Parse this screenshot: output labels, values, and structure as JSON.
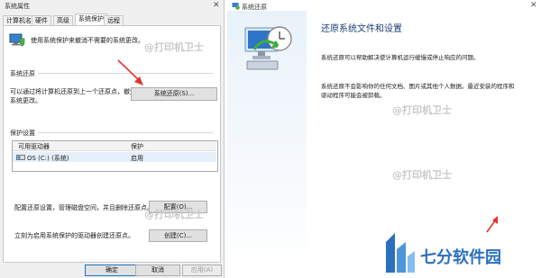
{
  "dialog": {
    "title": "系统属性",
    "close": "✕",
    "tabs": [
      "计算机名",
      "硬件",
      "高级",
      "系统保护",
      "远程"
    ],
    "intro": "使用系统保护来撤消不需要的系统更改。",
    "restore_section": "系统还原",
    "restore_desc_1": "可以通过将计算机还原到上一个还原点，撤消",
    "restore_desc_2": "系统更改。",
    "restore_button": "系统还原(S)...",
    "protection_section": "保护设置",
    "list_headers": [
      "可用驱动器",
      "保护"
    ],
    "drive_name": "OS (C:) (系统)",
    "drive_status": "启用",
    "config_desc": "配置还原设置，管理磁盘空间，并且删除还原点。",
    "config_button": "配置(O)...",
    "create_desc": "立刻为启用系统保护的驱动器创建还原点。",
    "create_button": "创建(C)...",
    "ok": "确定",
    "cancel": "取消",
    "apply": "应用(A)"
  },
  "restore_window": {
    "title": "系统还原",
    "heading": "还原系统文件和设置",
    "p1": "系统还原可以帮助解决使计算机运行缓慢或停止响应的问题。",
    "p2a": "系统还原不会影响你的任何文档、图片或其他个人数据。最近安装的程序和",
    "p2b": "驱动程序可能会被卸载。",
    "close": "✕"
  },
  "watermarks": [
    "@打印机卫士",
    "@打印机卫士",
    "@打印机卫士",
    "@打印机卫士"
  ],
  "brand": {
    "name": "七分软件园",
    "color": "#2b6fbf"
  },
  "colors": {
    "arrow": "#e8322b",
    "accent": "#1a73c9"
  }
}
